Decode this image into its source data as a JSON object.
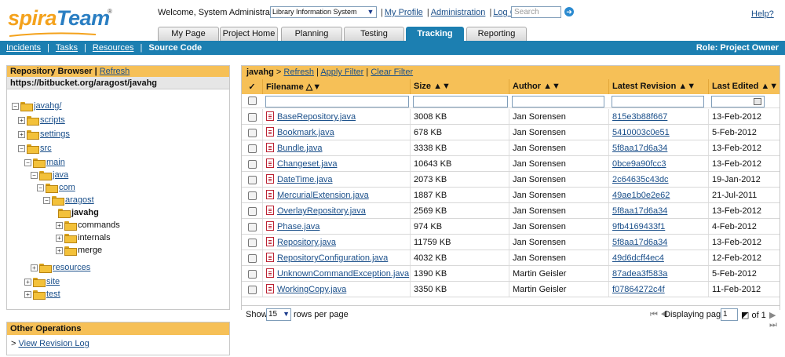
{
  "header": {
    "welcome": "Welcome, System Administrator",
    "project": "Library Information System",
    "links": [
      "My Profile",
      "Administration",
      "Log Out"
    ],
    "search_placeholder": "Search",
    "help": "Help?"
  },
  "tabs": [
    "My Page",
    "Project Home",
    "Planning",
    "Testing",
    "Tracking",
    "Reporting"
  ],
  "subnav": {
    "items": [
      "Incidents",
      "Tasks",
      "Resources"
    ],
    "current": "Source Code",
    "role": "Role: Project Owner"
  },
  "repo": {
    "title": "Repository Browser",
    "refresh": "Refresh",
    "url": "https://bitbucket.org/aragost/javahg",
    "tree": [
      {
        "label": "javahg/",
        "sign": "−"
      },
      {
        "label": "scripts",
        "sign": "+"
      },
      {
        "label": "settings",
        "sign": "+"
      },
      {
        "label": "src",
        "sign": "−"
      },
      {
        "label": "main",
        "sign": "−"
      },
      {
        "label": "java",
        "sign": "−"
      },
      {
        "label": "com",
        "sign": "−"
      },
      {
        "label": "aragost",
        "sign": "−"
      },
      {
        "label": "javahg",
        "sign": ""
      },
      {
        "label": "commands",
        "sign": "+"
      },
      {
        "label": "internals",
        "sign": "+"
      },
      {
        "label": "merge",
        "sign": "+"
      },
      {
        "label": "resources",
        "sign": "+"
      },
      {
        "label": "site",
        "sign": "+"
      },
      {
        "label": "test",
        "sign": "+"
      }
    ]
  },
  "other": {
    "title": "Other Operations",
    "link": "View Revision Log"
  },
  "grid": {
    "crumb_folder": "javahg",
    "crumb_sep": ">",
    "actions": [
      "Refresh",
      "Apply Filter",
      "Clear Filter"
    ],
    "check_header": "✓",
    "columns": [
      "Filename",
      "Size",
      "Author",
      "Latest Revision",
      "Last Edited"
    ],
    "rows": [
      {
        "file": "BaseRepository.java",
        "size": "3008 KB",
        "author": "Jan Sorensen",
        "rev": "815e3b88f667",
        "date": "13-Feb-2012"
      },
      {
        "file": "Bookmark.java",
        "size": "678 KB",
        "author": "Jan Sorensen",
        "rev": "5410003c0e51",
        "date": "5-Feb-2012"
      },
      {
        "file": "Bundle.java",
        "size": "3338 KB",
        "author": "Jan Sorensen",
        "rev": "5f8aa17d6a34",
        "date": "13-Feb-2012"
      },
      {
        "file": "Changeset.java",
        "size": "10643 KB",
        "author": "Jan Sorensen",
        "rev": "0bce9a90fcc3",
        "date": "13-Feb-2012"
      },
      {
        "file": "DateTime.java",
        "size": "2073 KB",
        "author": "Jan Sorensen",
        "rev": "2c64635c43dc",
        "date": "19-Jan-2012"
      },
      {
        "file": "MercurialExtension.java",
        "size": "1887 KB",
        "author": "Jan Sorensen",
        "rev": "49ae1b0e2e62",
        "date": "21-Jul-2011"
      },
      {
        "file": "OverlayRepository.java",
        "size": "2569 KB",
        "author": "Jan Sorensen",
        "rev": "5f8aa17d6a34",
        "date": "13-Feb-2012"
      },
      {
        "file": "Phase.java",
        "size": "974 KB",
        "author": "Jan Sorensen",
        "rev": "9fb4169433f1",
        "date": "4-Feb-2012"
      },
      {
        "file": "Repository.java",
        "size": "11759 KB",
        "author": "Jan Sorensen",
        "rev": "5f8aa17d6a34",
        "date": "13-Feb-2012"
      },
      {
        "file": "RepositoryConfiguration.java",
        "size": "4032 KB",
        "author": "Jan Sorensen",
        "rev": "49d6dcff4ec4",
        "date": "12-Feb-2012"
      },
      {
        "file": "UnknownCommandException.java",
        "size": "1390 KB",
        "author": "Martin Geisler",
        "rev": "87adea3f583a",
        "date": "5-Feb-2012"
      },
      {
        "file": "WorkingCopy.java",
        "size": "3350 KB",
        "author": "Martin Geisler",
        "rev": "f07864272c4f",
        "date": "11-Feb-2012"
      }
    ],
    "footer": {
      "show": "Show",
      "rows_value": "15",
      "rows_per_page": "rows per page",
      "displaying": "Displaying page",
      "page": "1",
      "of": "of 1"
    }
  }
}
